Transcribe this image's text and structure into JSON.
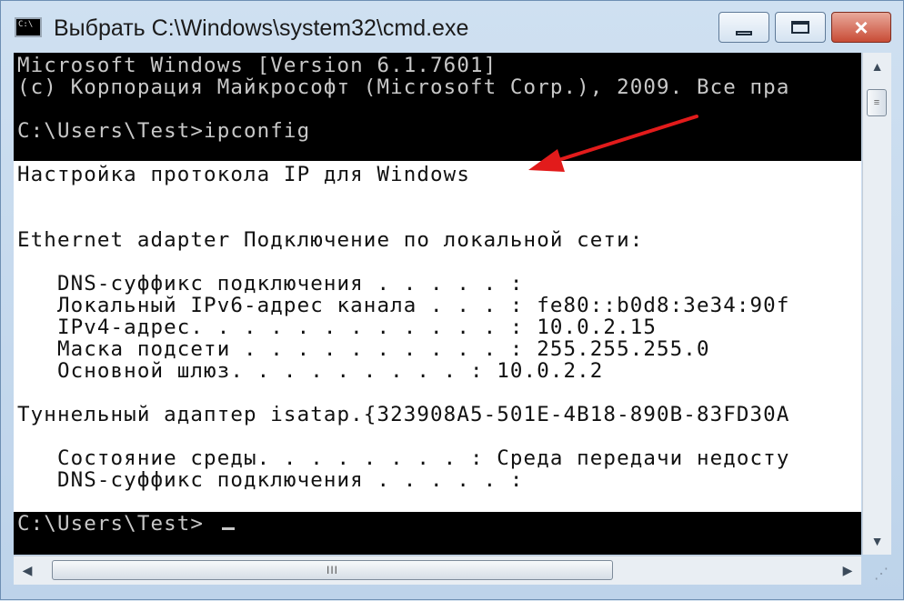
{
  "window": {
    "title": "Выбрать C:\\Windows\\system32\\cmd.exe"
  },
  "icons": {
    "app": "cmd-icon",
    "minimize": "minimize-icon",
    "maximize": "maximize-icon",
    "close": "close-icon",
    "grip": "resize-grip-icon"
  },
  "colors": {
    "console_bg": "#000000",
    "console_text": "#c8c8c8",
    "selection_bg": "#ffffff",
    "selection_text": "#111111",
    "annotation_arrow": "#e21b1b"
  },
  "console": {
    "lines": [
      "Microsoft Windows [Version 6.1.7601]",
      "(c) Корпорация Майкрософт (Microsoft Corp.), 2009. Все пра",
      "",
      "C:\\Users\\Test>ipconfig",
      "",
      "Настройка протокола IP для Windows",
      "",
      "",
      "Ethernet adapter Подключение по локальной сети:",
      "",
      "   DNS-суффикс подключения . . . . . :",
      "   Локальный IPv6-адрес канала . . . : fe80::b0d8:3e34:90f",
      "   IPv4-адрес. . . . . . . . . . . . : 10.0.2.15",
      "   Маска подсети . . . . . . . . . . : 255.255.255.0",
      "   Основной шлюз. . . . . . . . . : 10.0.2.2",
      "",
      "Туннельный адаптер isatap.{323908A5-501E-4B18-890B-83FD30A",
      "",
      "   Состояние среды. . . . . . . . : Среда передачи недосту",
      "   DNS-суффикс подключения . . . . . :",
      "",
      "C:\\Users\\Test>"
    ]
  },
  "scrollbars": {
    "up": "▲",
    "down": "▼",
    "left": "◀",
    "right": "▶",
    "vthumb_grip": "≡",
    "hthumb_grip": "III"
  }
}
